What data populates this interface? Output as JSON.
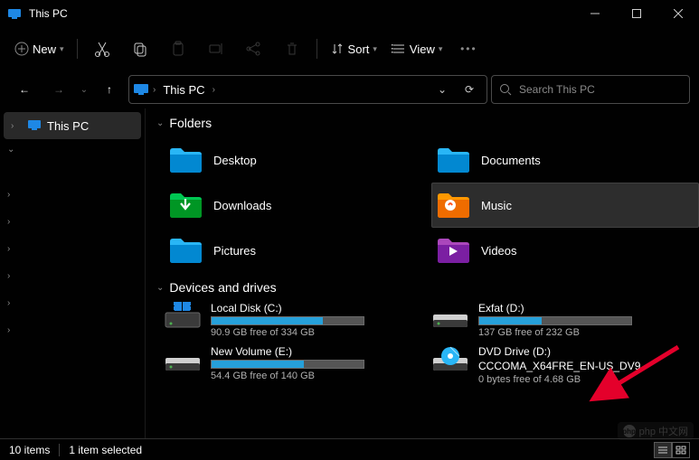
{
  "window": {
    "title": "This PC"
  },
  "toolbar": {
    "new_label": "New",
    "sort_label": "Sort",
    "view_label": "View"
  },
  "addressbar": {
    "crumb": "This PC",
    "search_placeholder": "Search This PC"
  },
  "sidebar": {
    "root": "This PC"
  },
  "groups": {
    "folders": "Folders",
    "devices": "Devices and drives"
  },
  "folders": [
    {
      "name": "Desktop",
      "scheme": "blue"
    },
    {
      "name": "Documents",
      "scheme": "blue"
    },
    {
      "name": "Downloads",
      "scheme": "green"
    },
    {
      "name": "Music",
      "scheme": "orange",
      "selected": true
    },
    {
      "name": "Pictures",
      "scheme": "blue"
    },
    {
      "name": "Videos",
      "scheme": "purple"
    }
  ],
  "drives": [
    {
      "name": "Local Disk (C:)",
      "free": "90.9 GB free of 334 GB",
      "fill": 73,
      "type": "win"
    },
    {
      "name": "Exfat (D:)",
      "free": "137 GB free of 232 GB",
      "fill": 41,
      "type": "hdd"
    },
    {
      "name": "New Volume (E:)",
      "free": "54.4 GB free of 140 GB",
      "fill": 61,
      "type": "hdd"
    },
    {
      "name": "DVD Drive (D:)",
      "sub": "CCCOMA_X64FRE_EN-US_DV9",
      "free": "0 bytes free of 4.68 GB",
      "type": "dvd"
    }
  ],
  "status": {
    "items": "10 items",
    "selected": "1 item selected"
  },
  "watermark": "php 中文网"
}
